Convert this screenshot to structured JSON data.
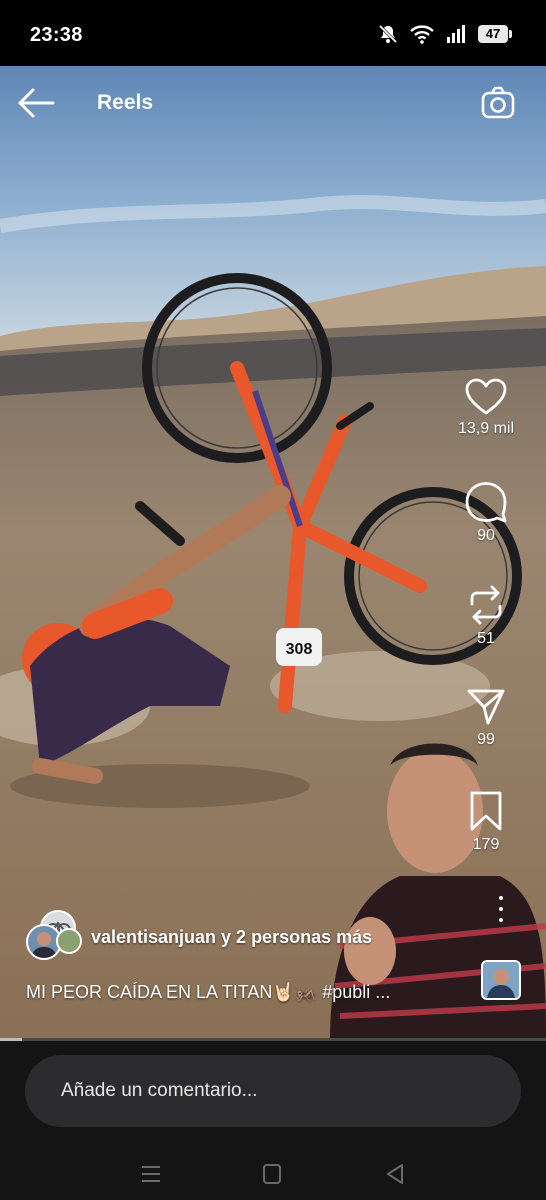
{
  "status": {
    "time": "23:38",
    "battery": "47",
    "icons": [
      "mute-icon",
      "wifi-icon",
      "signal-icon",
      "battery-icon"
    ]
  },
  "header": {
    "title": "Reels",
    "back_icon": "arrow-left-icon",
    "camera_icon": "camera-icon"
  },
  "actions": {
    "likes": "13,9 mil",
    "comments": "90",
    "reposts": "51",
    "shares": "99",
    "saves": "179"
  },
  "post": {
    "names": "valentisanjuan y 2 personas más",
    "caption": "MI PEOR CAÍDA EN LA TITAN🤘🏻🦗 #publi ...",
    "bib_number": "308"
  },
  "progress": 0.04,
  "comment": {
    "placeholder": "Añade un comentario..."
  },
  "colors": {
    "background": "#000000",
    "bottom_bar": "#141414",
    "input": "#2c2c2e",
    "bike": "#e8582a"
  }
}
